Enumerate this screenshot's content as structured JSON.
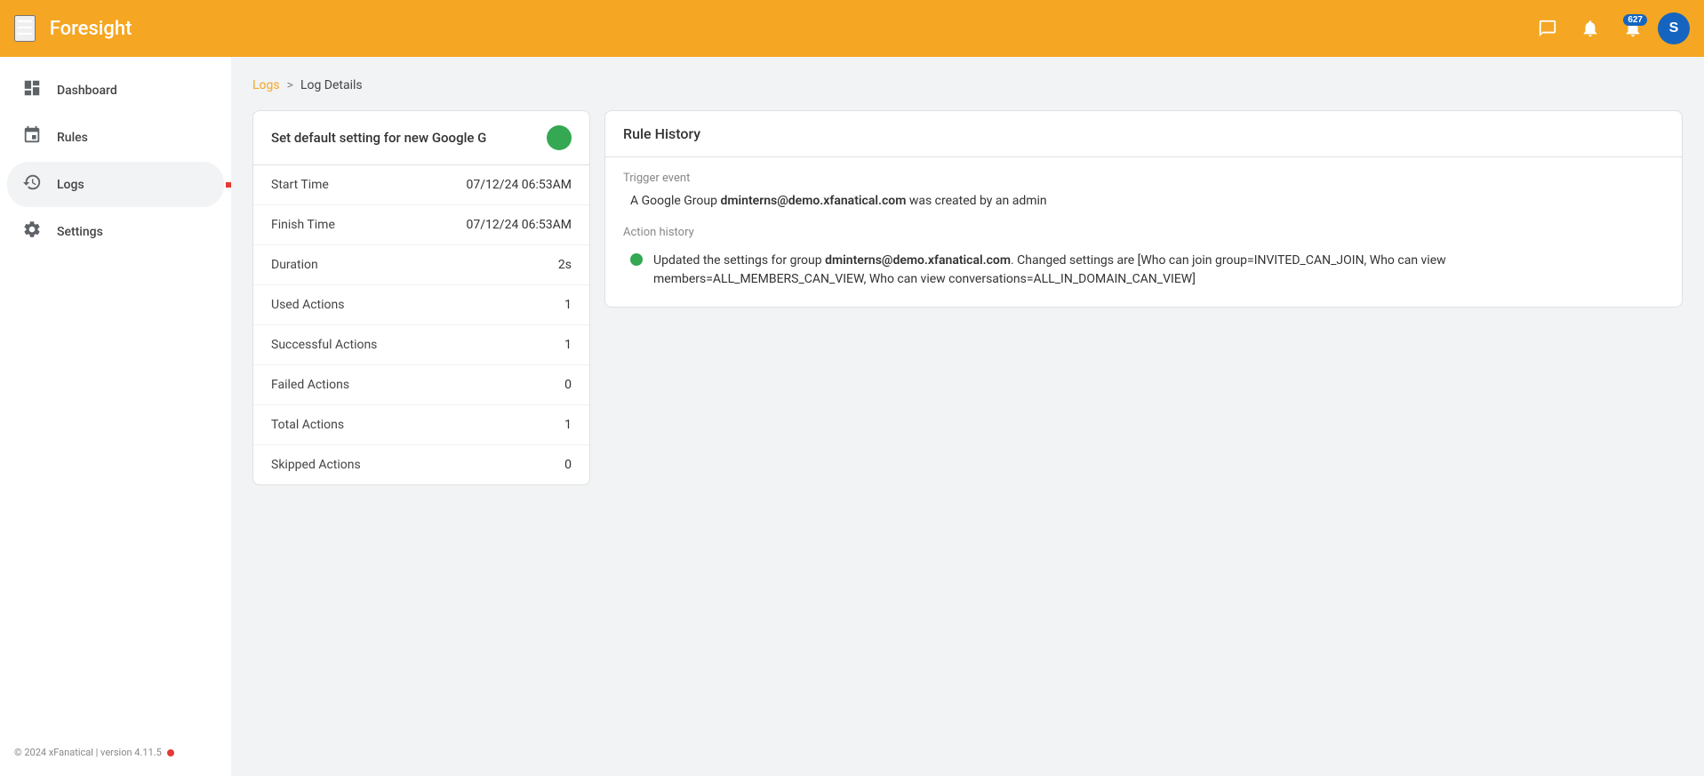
{
  "header": {
    "menu_icon": "☰",
    "title": "Foresight",
    "notification_badge": "627",
    "avatar_letter": "S"
  },
  "sidebar": {
    "nav_items": [
      {
        "id": "dashboard",
        "label": "Dashboard",
        "icon": "⊙",
        "active": false
      },
      {
        "id": "rules",
        "label": "Rules",
        "icon": "⌥",
        "active": false
      },
      {
        "id": "logs",
        "label": "Logs",
        "icon": "⏱",
        "active": true
      },
      {
        "id": "settings",
        "label": "Settings",
        "icon": "⚙",
        "active": false
      }
    ],
    "footer": "© 2024 xFanatical | version 4.11.5"
  },
  "breadcrumb": {
    "logs_label": "Logs",
    "separator": ">",
    "current": "Log Details"
  },
  "left_card": {
    "title": "Set default setting for new Google G",
    "rows": [
      {
        "label": "Start Time",
        "value": "07/12/24 06:53AM"
      },
      {
        "label": "Finish Time",
        "value": "07/12/24 06:53AM"
      },
      {
        "label": "Duration",
        "value": "2s"
      },
      {
        "label": "Used Actions",
        "value": "1"
      },
      {
        "label": "Successful Actions",
        "value": "1"
      },
      {
        "label": "Failed Actions",
        "value": "0"
      },
      {
        "label": "Total Actions",
        "value": "1"
      },
      {
        "label": "Skipped Actions",
        "value": "0"
      }
    ]
  },
  "right_card": {
    "title": "Rule History",
    "trigger_section_label": "Trigger event",
    "trigger_text_prefix": "A Google Group ",
    "trigger_group_email": "dminterns@demo.xfanatical.com",
    "trigger_text_suffix": " was created by an admin",
    "action_section_label": "Action history",
    "action_text_prefix": "Updated the settings for group ",
    "action_group_email": "dminterns@demo.xfanatical.com",
    "action_text_suffix": ". Changed settings are [Who can join group=INVITED_CAN_JOIN, Who can view members=ALL_MEMBERS_CAN_VIEW, Who can view conversations=ALL_IN_DOMAIN_CAN_VIEW]"
  }
}
